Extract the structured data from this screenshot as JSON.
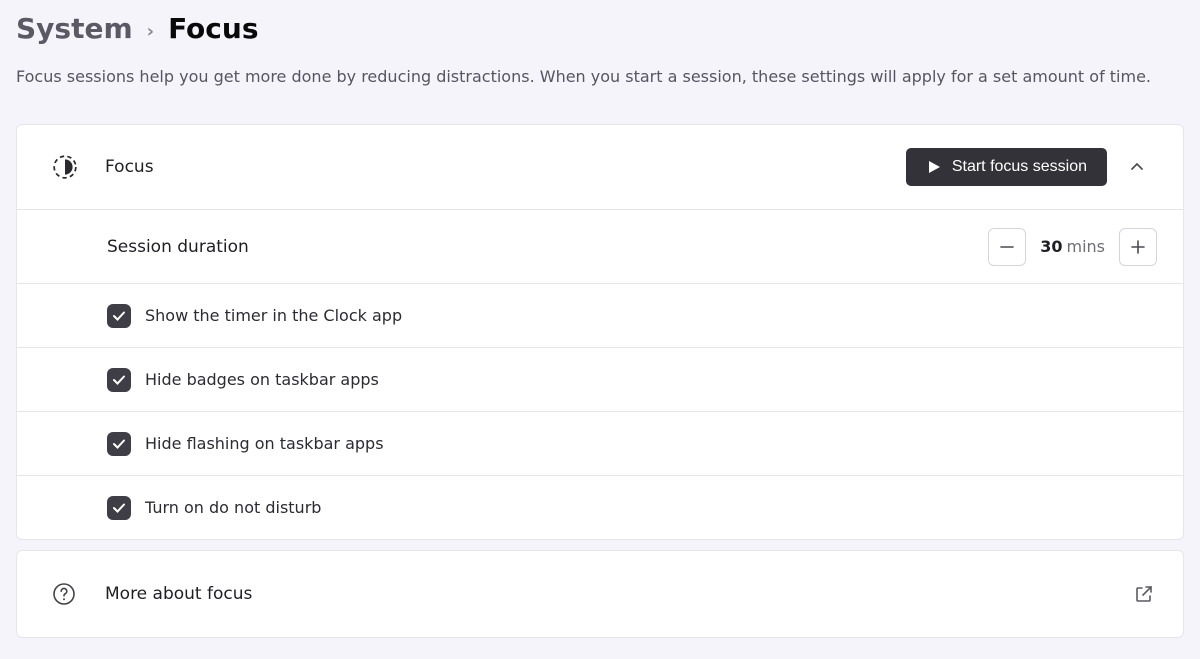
{
  "breadcrumb": {
    "parent": "System",
    "current": "Focus"
  },
  "description": "Focus sessions help you get more done by reducing distractions. When you start a session, these settings will apply for a set amount of time.",
  "section": {
    "title": "Focus",
    "start_button": "Start focus session"
  },
  "duration": {
    "label": "Session duration",
    "value": "30",
    "unit": "mins"
  },
  "options": [
    {
      "label": "Show the timer in the Clock app",
      "checked": true
    },
    {
      "label": "Hide badges on taskbar apps",
      "checked": true
    },
    {
      "label": "Hide flashing on taskbar apps",
      "checked": true
    },
    {
      "label": "Turn on do not disturb",
      "checked": true
    }
  ],
  "more": {
    "label": "More about focus"
  }
}
